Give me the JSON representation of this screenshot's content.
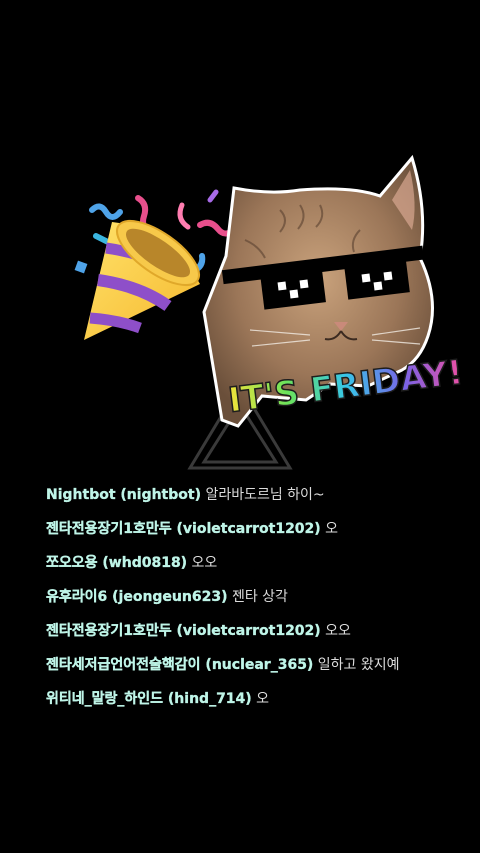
{
  "overlay": {
    "banner_text": "IT'S FRIDAY!",
    "colors": {
      "background": "#000000",
      "username": "#bff5e8",
      "message": "#dcdcdc"
    },
    "icons": [
      "party-popper-icon",
      "cat-with-sunglasses-icon",
      "triangle-logo-icon"
    ]
  },
  "chat": {
    "messages": [
      {
        "user": "Nightbot (nightbot)",
        "text": "알라바도르님 하이~"
      },
      {
        "user": "젠타전용장기1호만두 (violetcarrot1202)",
        "text": "오"
      },
      {
        "user": "쪼오오용 (whd0818)",
        "text": "오오"
      },
      {
        "user": "유후라이6 (jeongeun623)",
        "text": "젠타 상각"
      },
      {
        "user": "젠타전용장기1호만두 (violetcarrot1202)",
        "text": "오오"
      },
      {
        "user": "젠타세저급언어전술핵감이 (nuclear_365)",
        "text": "일하고 왔지예"
      },
      {
        "user": "위티네_말랑_하인드 (hind_714)",
        "text": "오"
      }
    ]
  }
}
